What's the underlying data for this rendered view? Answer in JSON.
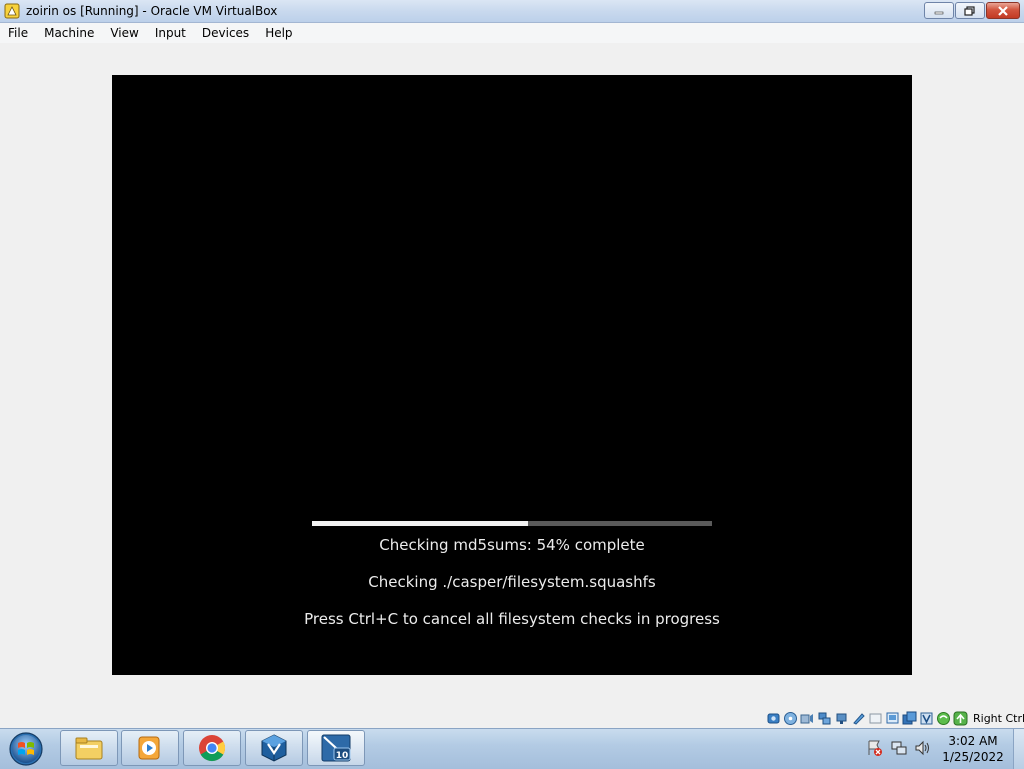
{
  "window": {
    "title": "zoirin os [Running] - Oracle VM VirtualBox"
  },
  "menubar": {
    "items": [
      "File",
      "Machine",
      "View",
      "Input",
      "Devices",
      "Help"
    ]
  },
  "vm": {
    "progress_fraction": 0.54,
    "line1": "Checking md5sums: 54% complete",
    "line2": "Checking ./casper/filesystem.squashfs",
    "line3": "Press Ctrl+C to cancel all filesystem checks in progress"
  },
  "statusbar": {
    "icons": [
      "hard-disk-icon",
      "optical-drive-icon",
      "audio-icon",
      "network-icon",
      "usb-icon",
      "shared-folders-icon",
      "display-icon",
      "screen-capture-icon",
      "recording-icon",
      "cpu-icon",
      "mouse-integration-icon",
      "arrow-icon"
    ],
    "host_key": "Right Ctrl"
  },
  "taskbar": {
    "buttons": [
      "file-explorer-icon",
      "media-player-icon",
      "chrome-icon",
      "virtualbox-icon",
      "zorin-vm-icon"
    ],
    "zorin_badge": "10",
    "clock_time": "3:02 AM",
    "clock_date": "1/25/2022"
  }
}
